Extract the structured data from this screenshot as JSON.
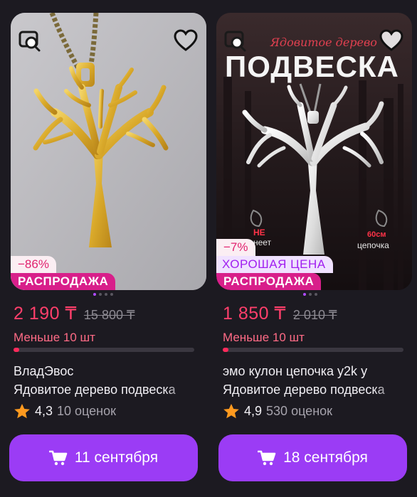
{
  "products": [
    {
      "discount": "−86%",
      "good_price": "",
      "sale": "РАСПРОДАЖА",
      "price": "2 190 ₸",
      "old_price": "15 800 ₸",
      "stock": "Меньше 10 шт",
      "stock_level": 0.03,
      "brand": "ВладЭвос",
      "title": "Ядовитое дерево подвеска",
      "rating": "4,3",
      "reviews": "10 оценок",
      "delivery": "11 сентября",
      "image_dots": 4,
      "image_active": 0
    },
    {
      "discount": "−7%",
      "good_price": "ХОРОШАЯ ЦЕНА",
      "sale": "РАСПРОДАЖА",
      "price": "1 850 ₸",
      "old_price": "2 010 ₸",
      "stock": "Меньше 10 шт",
      "stock_level": 0.03,
      "brand": "эмо кулон цепочка y2k у",
      "title": "Ядовитое дерево подвеска",
      "rating": "4,9",
      "reviews": "530 оценок",
      "delivery": "18 сентября",
      "image_dots": 3,
      "image_active": 0,
      "promo": {
        "script_title": "Ядовитое дерево",
        "big_title": "ПОДВЕСКА",
        "left_caption_top": "НЕ",
        "left_caption_bottom": "неет",
        "right_caption_top": "60см",
        "right_caption_bottom": "цепочка"
      }
    }
  ],
  "colors": {
    "background": "#1c1a21",
    "price": "#ff3f6b",
    "button": "#9b3cf5",
    "sale_badge": "#d81f8a",
    "star": "#ff9a1f"
  },
  "icons": {
    "search": "image-search-icon",
    "favorite": "heart-icon",
    "cart": "cart-icon",
    "star": "star-icon"
  }
}
